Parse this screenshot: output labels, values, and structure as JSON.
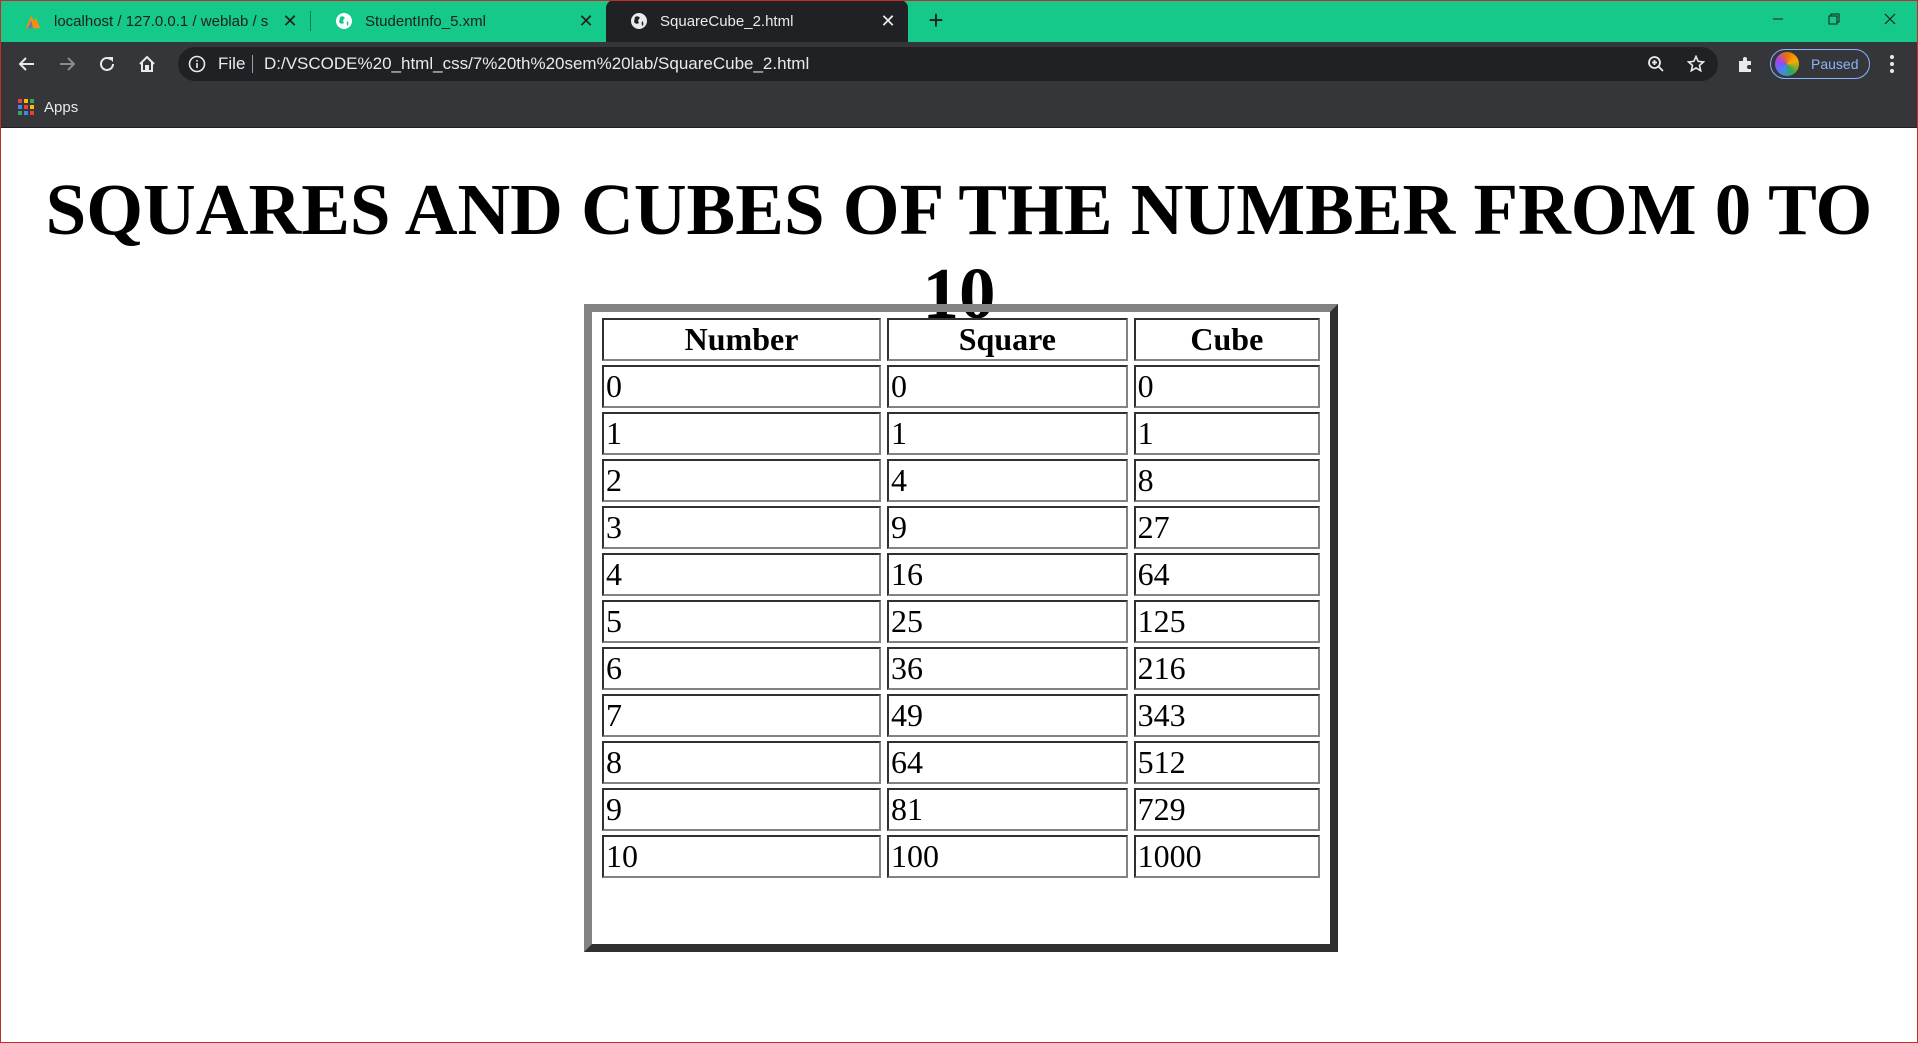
{
  "browser": {
    "tabs": [
      {
        "title": "localhost / 127.0.0.1 / weblab / s",
        "icon": "phpmyadmin-icon",
        "active": false
      },
      {
        "title": "StudentInfo_5.xml",
        "icon": "globe-icon",
        "active": false
      },
      {
        "title": "SquareCube_2.html",
        "icon": "globe-icon",
        "active": true
      }
    ],
    "address": {
      "scheme_label": "File",
      "url": "D:/VSCODE%20_html_css/7%20th%20sem%20lab/SquareCube_2.html"
    },
    "profile_status": "Paused",
    "bookmarks": {
      "apps_label": "Apps"
    },
    "colors": {
      "tabstrip": "#14c98a",
      "toolbar": "#35363a",
      "omnibox": "#202124",
      "profile_accent": "#8ab4f8"
    }
  },
  "page": {
    "heading": "SQUARES AND CUBES OF THE NUMBER FROM 0 TO 10",
    "table": {
      "headers": [
        "Number",
        "Square",
        "Cube"
      ],
      "rows": [
        [
          "0",
          "0",
          "0"
        ],
        [
          "1",
          "1",
          "1"
        ],
        [
          "2",
          "4",
          "8"
        ],
        [
          "3",
          "9",
          "27"
        ],
        [
          "4",
          "16",
          "64"
        ],
        [
          "5",
          "25",
          "125"
        ],
        [
          "6",
          "36",
          "216"
        ],
        [
          "7",
          "49",
          "343"
        ],
        [
          "8",
          "64",
          "512"
        ],
        [
          "9",
          "81",
          "729"
        ],
        [
          "10",
          "100",
          "1000"
        ]
      ]
    }
  }
}
